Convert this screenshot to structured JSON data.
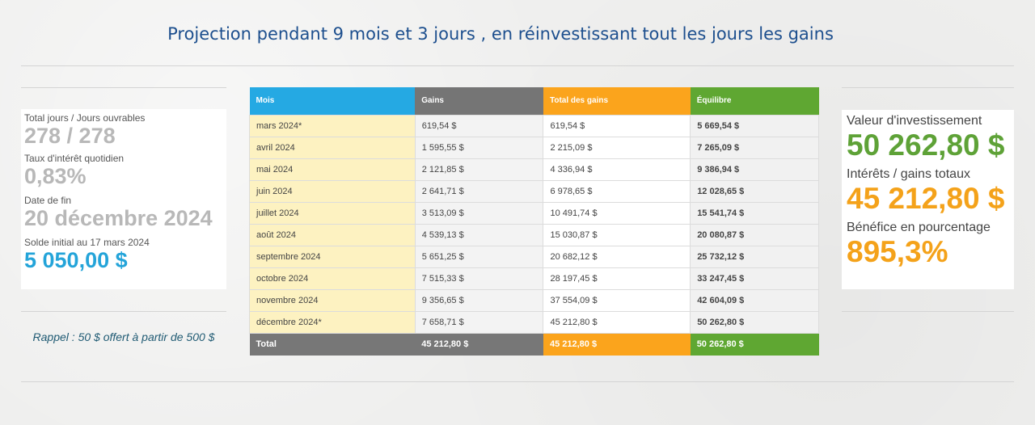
{
  "header": {
    "title": "Projection pendant 9 mois et 3 jours , en réinvestissant tout les jours les gains"
  },
  "summary_left": {
    "days_label": "Total jours / Jours ouvrables",
    "days_value": "278 / 278",
    "rate_label": "Taux d'intérêt quotidien",
    "rate_value": "0,83%",
    "end_label": "Date de fin",
    "end_value": "20 décembre 2024",
    "initial_label": "Solde initial au 17 mars 2024",
    "initial_value": "5 050,00 $"
  },
  "reminder": "Rappel : 50 $ offert à partir de 500 $",
  "table": {
    "headers": [
      "Mois",
      "Gains",
      "Total des gains",
      "Équilibre"
    ],
    "rows": [
      [
        "mars 2024*",
        "619,54 $",
        "619,54 $",
        "5 669,54 $"
      ],
      [
        "avril 2024",
        "1 595,55 $",
        "2 215,09 $",
        "7 265,09 $"
      ],
      [
        "mai 2024",
        "2 121,85 $",
        "4 336,94 $",
        "9 386,94 $"
      ],
      [
        "juin 2024",
        "2 641,71 $",
        "6 978,65 $",
        "12 028,65 $"
      ],
      [
        "juillet 2024",
        "3 513,09 $",
        "10 491,74 $",
        "15 541,74 $"
      ],
      [
        "août 2024",
        "4 539,13 $",
        "15 030,87 $",
        "20 080,87 $"
      ],
      [
        "septembre 2024",
        "5 651,25 $",
        "20 682,12 $",
        "25 732,12 $"
      ],
      [
        "octobre 2024",
        "7 515,33 $",
        "28 197,45 $",
        "33 247,45 $"
      ],
      [
        "novembre 2024",
        "9 356,65 $",
        "37 554,09 $",
        "42 604,09 $"
      ],
      [
        "décembre 2024*",
        "7 658,71 $",
        "45 212,80 $",
        "50 262,80 $"
      ]
    ],
    "total": [
      "Total",
      "45 212,80 $",
      "45 212,80 $",
      "50 262,80 $"
    ]
  },
  "summary_right": {
    "invest_label": "Valeur d'investissement",
    "invest_value": "50 262,80 $",
    "interest_label": "Intérêts / gains totaux",
    "interest_value": "45 212,80 $",
    "profit_label": "Bénéfice en pourcentage",
    "profit_value": "895,3%"
  },
  "colors": {
    "title": "#1d4f8e",
    "mois_header": "#25a9e3",
    "gains_header": "#757575",
    "total_header": "#fba41c",
    "equilibre_header": "#5fa732"
  }
}
